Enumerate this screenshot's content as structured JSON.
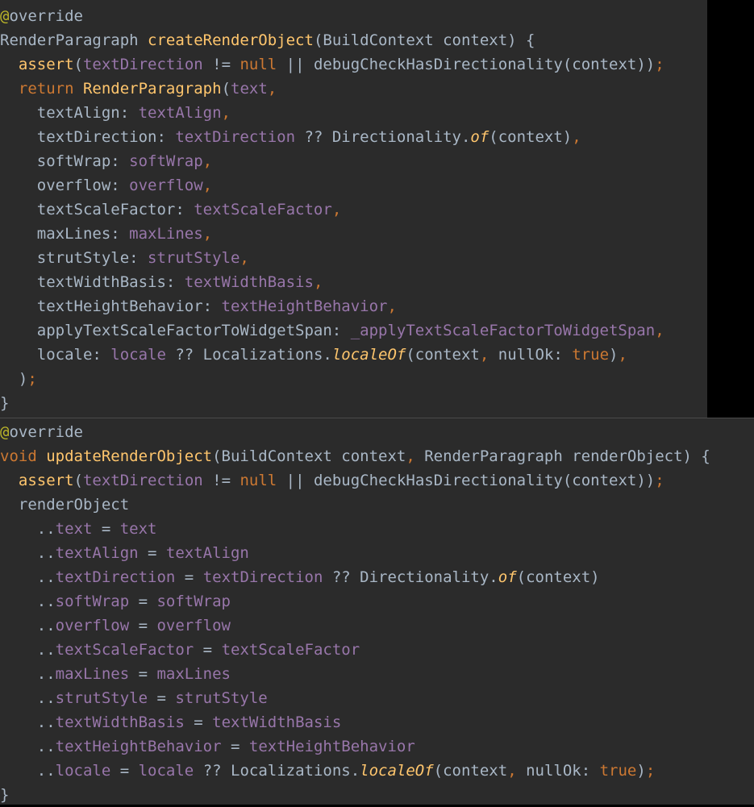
{
  "colors": {
    "background": "#2b2b2b",
    "plain": "#a9b7c6",
    "keyword": "#cc7832",
    "function": "#ffc66d",
    "field": "#9876aa",
    "annotation": "#bbb529"
  },
  "panels": [
    {
      "name": "create-render-object-panel",
      "lines": [
        [
          [
            "ann",
            "@"
          ],
          [
            "pl",
            "override"
          ]
        ],
        [
          [
            "pl",
            "RenderParagraph "
          ],
          [
            "fn",
            "createRenderObject"
          ],
          [
            "pl",
            "(BuildContext context) {"
          ]
        ],
        [
          [
            "pl",
            "  "
          ],
          [
            "fn",
            "assert"
          ],
          [
            "pl",
            "("
          ],
          [
            "fld",
            "textDirection"
          ],
          [
            "pl",
            " != "
          ],
          [
            "kw",
            "null"
          ],
          [
            "pl",
            " || debugCheckHasDirectionality(context))"
          ],
          [
            "pn",
            ";"
          ]
        ],
        [
          [
            "pl",
            "  "
          ],
          [
            "kw",
            "return "
          ],
          [
            "fn",
            "RenderParagraph"
          ],
          [
            "pl",
            "("
          ],
          [
            "fld",
            "text"
          ],
          [
            "pn",
            ","
          ]
        ],
        [
          [
            "pl",
            "    textAlign: "
          ],
          [
            "fld",
            "textAlign"
          ],
          [
            "pn",
            ","
          ]
        ],
        [
          [
            "pl",
            "    textDirection: "
          ],
          [
            "fld",
            "textDirection"
          ],
          [
            "pl",
            " ?? Directionality."
          ],
          [
            "it",
            "of"
          ],
          [
            "pl",
            "(context)"
          ],
          [
            "pn",
            ","
          ]
        ],
        [
          [
            "pl",
            "    softWrap: "
          ],
          [
            "fld",
            "softWrap"
          ],
          [
            "pn",
            ","
          ]
        ],
        [
          [
            "pl",
            "    overflow: "
          ],
          [
            "fld",
            "overflow"
          ],
          [
            "pn",
            ","
          ]
        ],
        [
          [
            "pl",
            "    textScaleFactor: "
          ],
          [
            "fld",
            "textScaleFactor"
          ],
          [
            "pn",
            ","
          ]
        ],
        [
          [
            "pl",
            "    maxLines: "
          ],
          [
            "fld",
            "maxLines"
          ],
          [
            "pn",
            ","
          ]
        ],
        [
          [
            "pl",
            "    strutStyle: "
          ],
          [
            "fld",
            "strutStyle"
          ],
          [
            "pn",
            ","
          ]
        ],
        [
          [
            "pl",
            "    textWidthBasis: "
          ],
          [
            "fld",
            "textWidthBasis"
          ],
          [
            "pn",
            ","
          ]
        ],
        [
          [
            "pl",
            "    textHeightBehavior: "
          ],
          [
            "fld",
            "textHeightBehavior"
          ],
          [
            "pn",
            ","
          ]
        ],
        [
          [
            "pl",
            "    applyTextScaleFactorToWidgetSpan: "
          ],
          [
            "fld",
            "_applyTextScaleFactorToWidgetSpan"
          ],
          [
            "pn",
            ","
          ]
        ],
        [
          [
            "pl",
            "    locale: "
          ],
          [
            "fld",
            "locale"
          ],
          [
            "pl",
            " ?? Localizations."
          ],
          [
            "it",
            "localeOf"
          ],
          [
            "pl",
            "(context"
          ],
          [
            "pn",
            ","
          ],
          [
            "pl",
            " nullOk: "
          ],
          [
            "kw",
            "true"
          ],
          [
            "pl",
            ")"
          ],
          [
            "pn",
            ","
          ]
        ],
        [
          [
            "pl",
            "  )"
          ],
          [
            "pn",
            ";"
          ]
        ],
        [
          [
            "pl",
            "}"
          ]
        ]
      ]
    },
    {
      "name": "update-render-object-panel",
      "lines": [
        [
          [
            "ann",
            "@"
          ],
          [
            "pl",
            "override"
          ]
        ],
        [
          [
            "kw",
            "void "
          ],
          [
            "fn",
            "updateRenderObject"
          ],
          [
            "pl",
            "(BuildContext context"
          ],
          [
            "pn",
            ","
          ],
          [
            "pl",
            " RenderParagraph renderObject) {"
          ]
        ],
        [
          [
            "pl",
            "  "
          ],
          [
            "fn",
            "assert"
          ],
          [
            "pl",
            "("
          ],
          [
            "fld",
            "textDirection"
          ],
          [
            "pl",
            " != "
          ],
          [
            "kw",
            "null"
          ],
          [
            "pl",
            " || debugCheckHasDirectionality(context))"
          ],
          [
            "pn",
            ";"
          ]
        ],
        [
          [
            "pl",
            "  renderObject"
          ]
        ],
        [
          [
            "pl",
            "    .."
          ],
          [
            "fld",
            "text"
          ],
          [
            "pl",
            " = "
          ],
          [
            "fld",
            "text"
          ]
        ],
        [
          [
            "pl",
            "    .."
          ],
          [
            "fld",
            "textAlign"
          ],
          [
            "pl",
            " = "
          ],
          [
            "fld",
            "textAlign"
          ]
        ],
        [
          [
            "pl",
            "    .."
          ],
          [
            "fld",
            "textDirection"
          ],
          [
            "pl",
            " = "
          ],
          [
            "fld",
            "textDirection"
          ],
          [
            "pl",
            " ?? Directionality."
          ],
          [
            "it",
            "of"
          ],
          [
            "pl",
            "(context)"
          ]
        ],
        [
          [
            "pl",
            "    .."
          ],
          [
            "fld",
            "softWrap"
          ],
          [
            "pl",
            " = "
          ],
          [
            "fld",
            "softWrap"
          ]
        ],
        [
          [
            "pl",
            "    .."
          ],
          [
            "fld",
            "overflow"
          ],
          [
            "pl",
            " = "
          ],
          [
            "fld",
            "overflow"
          ]
        ],
        [
          [
            "pl",
            "    .."
          ],
          [
            "fld",
            "textScaleFactor"
          ],
          [
            "pl",
            " = "
          ],
          [
            "fld",
            "textScaleFactor"
          ]
        ],
        [
          [
            "pl",
            "    .."
          ],
          [
            "fld",
            "maxLines"
          ],
          [
            "pl",
            " = "
          ],
          [
            "fld",
            "maxLines"
          ]
        ],
        [
          [
            "pl",
            "    .."
          ],
          [
            "fld",
            "strutStyle"
          ],
          [
            "pl",
            " = "
          ],
          [
            "fld",
            "strutStyle"
          ]
        ],
        [
          [
            "pl",
            "    .."
          ],
          [
            "fld",
            "textWidthBasis"
          ],
          [
            "pl",
            " = "
          ],
          [
            "fld",
            "textWidthBasis"
          ]
        ],
        [
          [
            "pl",
            "    .."
          ],
          [
            "fld",
            "textHeightBehavior"
          ],
          [
            "pl",
            " = "
          ],
          [
            "fld",
            "textHeightBehavior"
          ]
        ],
        [
          [
            "pl",
            "    .."
          ],
          [
            "fld",
            "locale"
          ],
          [
            "pl",
            " = "
          ],
          [
            "fld",
            "locale"
          ],
          [
            "pl",
            " ?? Localizations."
          ],
          [
            "it",
            "localeOf"
          ],
          [
            "pl",
            "(context"
          ],
          [
            "pn",
            ","
          ],
          [
            "pl",
            " nullOk: "
          ],
          [
            "kw",
            "true"
          ],
          [
            "pl",
            ")"
          ],
          [
            "pn",
            ";"
          ]
        ],
        [
          [
            "pl",
            "}"
          ]
        ]
      ]
    }
  ]
}
